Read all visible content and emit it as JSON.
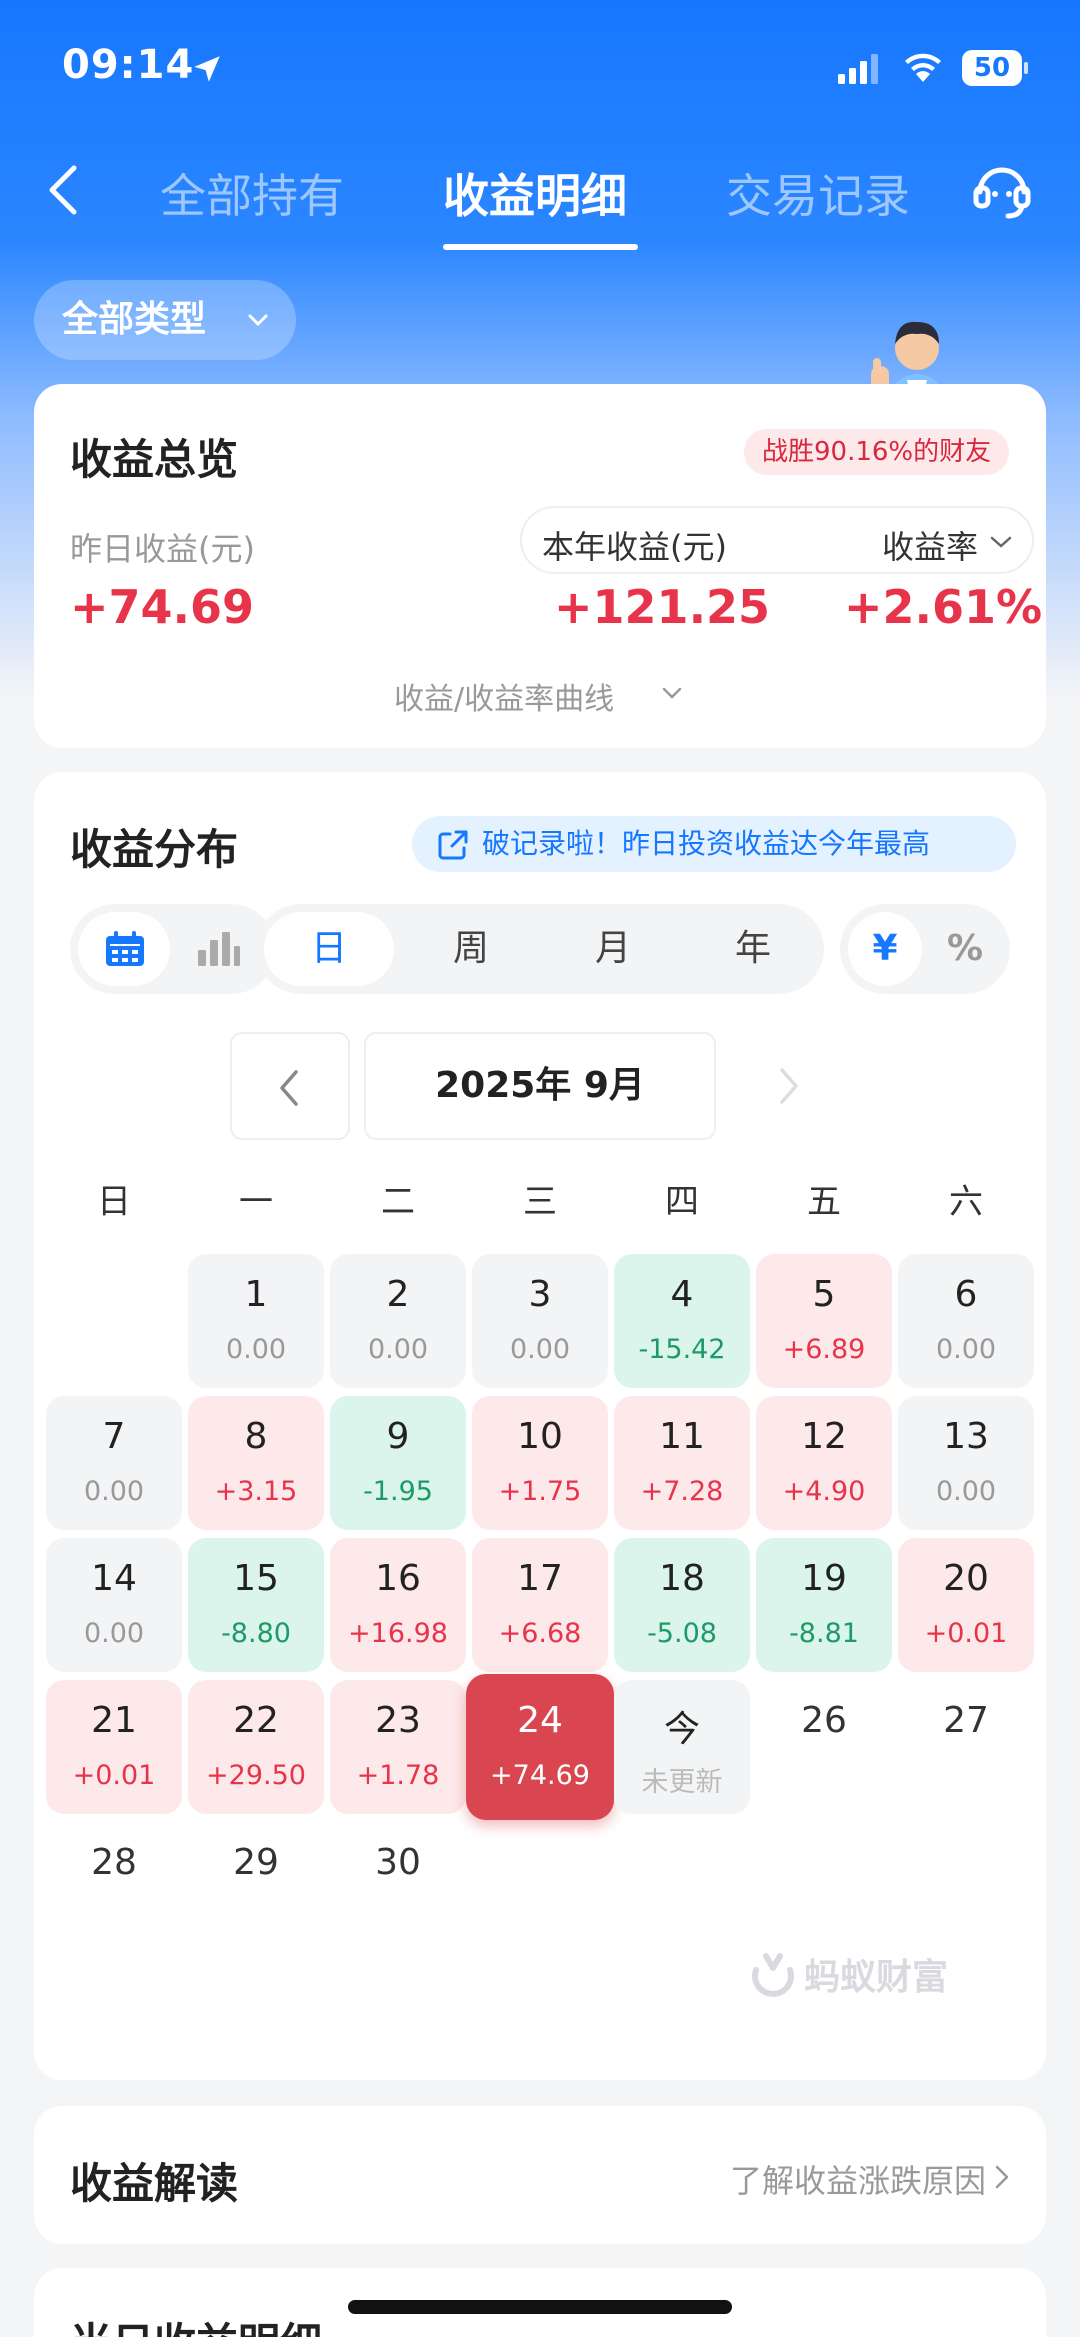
{
  "status_bar": {
    "time": "09:14",
    "battery": "50"
  },
  "nav": {
    "tabs": [
      {
        "label": "全部持有"
      },
      {
        "label": "收益明细"
      },
      {
        "label": "交易记录"
      }
    ],
    "active_tab": "收益明细"
  },
  "filter": {
    "type_label": "全部类型"
  },
  "overview": {
    "title": "收益总览",
    "badge": "战胜90.16%的财友",
    "yesterday_label": "昨日收益(元)",
    "yesterday_value": "+74.69",
    "year_label": "本年收益(元)",
    "year_value": "+121.25",
    "rate_label": "收益率",
    "rate_value": "+2.61%",
    "curve_toggle": "收益/收益率曲线"
  },
  "distribution": {
    "title": "收益分布",
    "record_banner": "破记录啦！昨日投资收益达今年最高",
    "periods": [
      "日",
      "周",
      "月",
      "年"
    ],
    "active_period": "日",
    "units": [
      "¥",
      "%"
    ],
    "active_unit": "¥",
    "month": "2025年 9月",
    "weekdays": [
      "日",
      "一",
      "二",
      "三",
      "四",
      "五",
      "六"
    ],
    "days": [
      {
        "day": "1",
        "value": "0.00"
      },
      {
        "day": "2",
        "value": "0.00"
      },
      {
        "day": "3",
        "value": "0.00"
      },
      {
        "day": "4",
        "value": "-15.42"
      },
      {
        "day": "5",
        "value": "+6.89"
      },
      {
        "day": "6",
        "value": "0.00"
      },
      {
        "day": "7",
        "value": "0.00"
      },
      {
        "day": "8",
        "value": "+3.15"
      },
      {
        "day": "9",
        "value": "-1.95"
      },
      {
        "day": "10",
        "value": "+1.75"
      },
      {
        "day": "11",
        "value": "+7.28"
      },
      {
        "day": "12",
        "value": "+4.90"
      },
      {
        "day": "13",
        "value": "0.00"
      },
      {
        "day": "14",
        "value": "0.00"
      },
      {
        "day": "15",
        "value": "-8.80"
      },
      {
        "day": "16",
        "value": "+16.98"
      },
      {
        "day": "17",
        "value": "+6.68"
      },
      {
        "day": "18",
        "value": "-5.08"
      },
      {
        "day": "19",
        "value": "-8.81"
      },
      {
        "day": "20",
        "value": "+0.01"
      },
      {
        "day": "21",
        "value": "+0.01"
      },
      {
        "day": "22",
        "value": "+29.50"
      },
      {
        "day": "23",
        "value": "+1.78"
      },
      {
        "day": "24",
        "value": "+74.69"
      },
      {
        "day": "今",
        "value": "未更新"
      },
      {
        "day": "26",
        "value": ""
      },
      {
        "day": "27",
        "value": ""
      },
      {
        "day": "28",
        "value": ""
      },
      {
        "day": "29",
        "value": ""
      },
      {
        "day": "30",
        "value": ""
      }
    ],
    "watermark": "蚂蚁财富"
  },
  "interpretation": {
    "title": "收益解读",
    "link": "了解收益涨跌原因"
  },
  "next_section": {
    "title": "当日收益明细"
  },
  "colors": {
    "brand_blue": "#1677ff",
    "gain_red": "#e8344b",
    "loss_green": "#1c9a68",
    "selected_red": "#d9464f"
  }
}
